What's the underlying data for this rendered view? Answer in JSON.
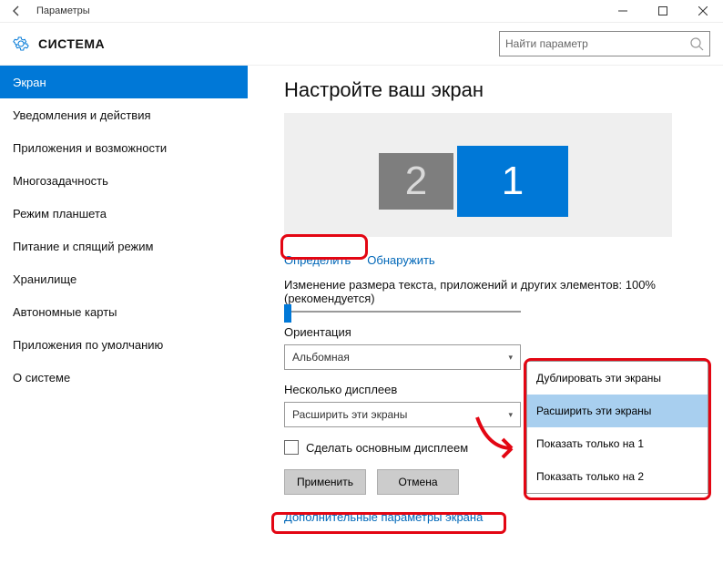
{
  "window": {
    "title": "Параметры"
  },
  "header": {
    "title": "СИСТЕМА",
    "search_placeholder": "Найти параметр"
  },
  "sidebar": {
    "items": [
      {
        "label": "Экран",
        "active": true
      },
      {
        "label": "Уведомления и действия"
      },
      {
        "label": "Приложения и возможности"
      },
      {
        "label": "Многозадачность"
      },
      {
        "label": "Режим планшета"
      },
      {
        "label": "Питание и спящий режим"
      },
      {
        "label": "Хранилище"
      },
      {
        "label": "Автономные карты"
      },
      {
        "label": "Приложения по умолчанию"
      },
      {
        "label": "О системе"
      }
    ]
  },
  "main": {
    "heading": "Настройте ваш экран",
    "monitors": {
      "m1": "1",
      "m2": "2"
    },
    "identify": "Определить",
    "detect": "Обнаружить",
    "scale_label": "Изменение размера текста, приложений и других элементов: 100% (рекомендуется)",
    "orientation_label": "Ориентация",
    "orientation_value": "Альбомная",
    "multi_label": "Несколько дисплеев",
    "multi_value": "Расширить эти экраны",
    "multi_options": [
      "Дублировать эти экраны",
      "Расширить эти экраны",
      "Показать только на 1",
      "Показать только на 2"
    ],
    "make_primary": "Сделать основным дисплеем",
    "apply": "Применить",
    "cancel": "Отмена",
    "advanced": "Дополнительные параметры экрана"
  }
}
